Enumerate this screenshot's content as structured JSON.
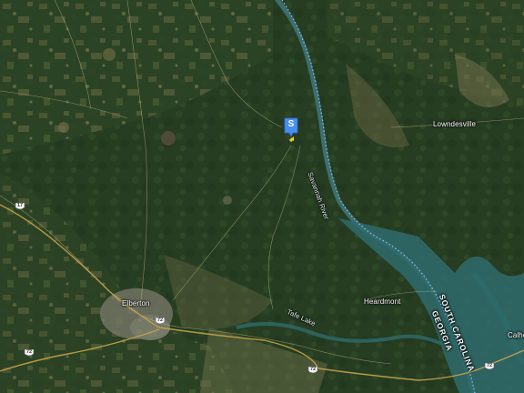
{
  "map": {
    "type": "satellite",
    "colors": {
      "forest": "#2e4526",
      "farmland": "#7d7a4e",
      "river": "#3d6e6e",
      "lake": "#2f6b6c",
      "state_border": "#8fc2ff",
      "highway": "#c8a44a",
      "label": "#ffffff"
    }
  },
  "marker": {
    "letter": "S",
    "color": "#4a8ef0",
    "icon": "map-pin"
  },
  "places": {
    "lowndesville": "Lowndesville",
    "elberton": "Elberton",
    "heardmont": "Heardmont",
    "calhoun": "Calho"
  },
  "water": {
    "savannah_river": "Savannah River",
    "taite_lake": "Tafe Lake"
  },
  "states": {
    "south_carolina": "SOUTH CAROLINA",
    "georgia": "GEORGIA"
  },
  "routes": {
    "r17": "17",
    "r72_elberton": "72",
    "r72_west": "72",
    "r72_south": "72",
    "r72_east": "72"
  }
}
